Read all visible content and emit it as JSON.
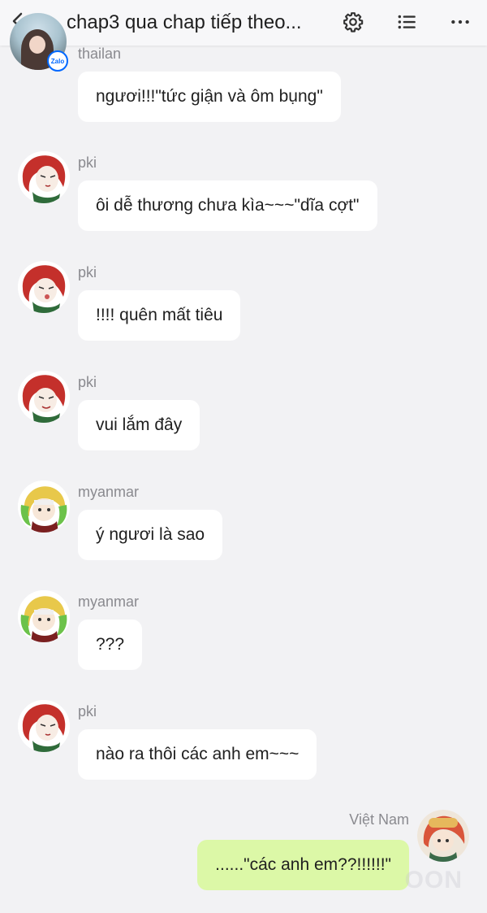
{
  "header": {
    "title": "chap3 qua chap tiếp theo...",
    "badge_text": "Zalo",
    "icons": [
      "back-icon",
      "gear-icon",
      "list-icon",
      "more-icon"
    ]
  },
  "messages": [
    {
      "sender": "thailan",
      "text": "ngươi!!!\"tức giận và ôm bụng\"",
      "avatar": "thailan-avatar"
    },
    {
      "sender": "pki",
      "text": "ôi dễ thương chưa kìa~~~\"dĩa cợt\"",
      "avatar": "pki-avatar"
    },
    {
      "sender": "pki",
      "text": "!!!! quên mất tiêu",
      "avatar": "pki-avatar"
    },
    {
      "sender": "pki",
      "text": "vui lắm đây",
      "avatar": "pki-avatar"
    },
    {
      "sender": "myanmar",
      "text": "ý ngươi là sao",
      "avatar": "myanmar-avatar"
    },
    {
      "sender": "myanmar",
      "text": "???",
      "avatar": "myanmar-avatar"
    },
    {
      "sender": "pki",
      "text": "nào ra thôi các anh em~~~",
      "avatar": "pki-avatar"
    },
    {
      "sender": "Việt Nam",
      "text": "......\"các anh em??!!!!!!\"",
      "avatar": "vietnam-avatar",
      "mine": true
    }
  ],
  "watermark": "OON",
  "colors": {
    "background": "#f2f2f4",
    "bubble_other": "#ffffff",
    "bubble_mine": "#dcf8a7",
    "sender_text": "#8a8a8f",
    "zalo_blue": "#0068ff"
  }
}
